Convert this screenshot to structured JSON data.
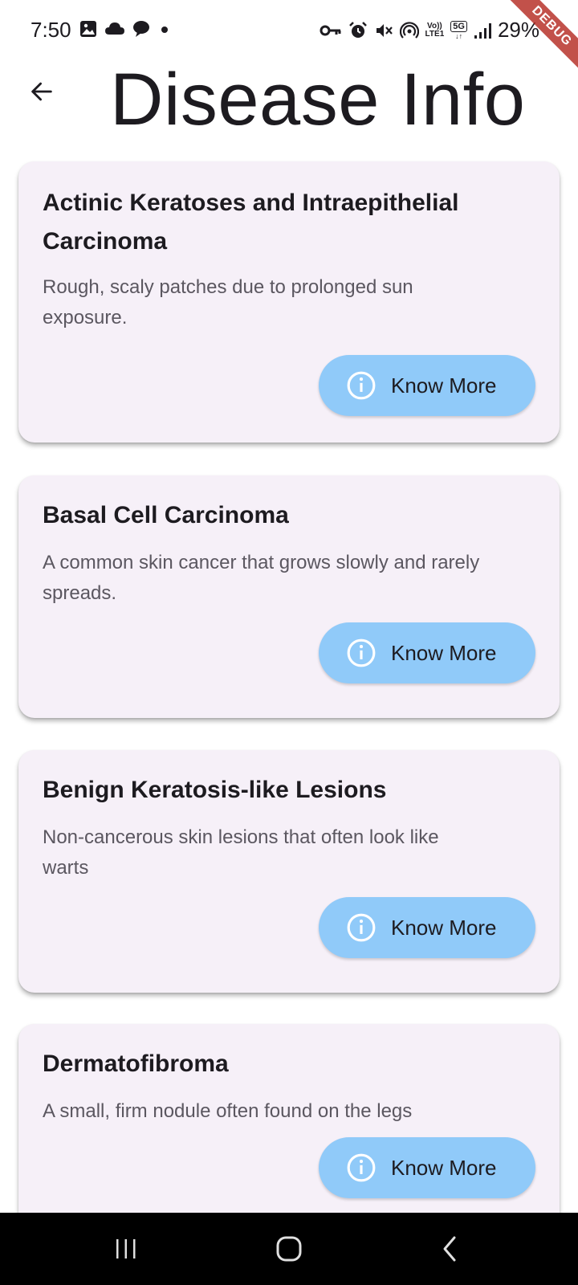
{
  "status_bar": {
    "time": "7:50",
    "left_icons": [
      "image-icon",
      "cloud-icon",
      "chat-icon",
      "dot-icon"
    ],
    "right_icons": [
      "key-icon",
      "alarm-icon",
      "mute-icon",
      "hotspot-icon",
      "volte-icon",
      "5g-icon",
      "signal-icon",
      "battery-icon"
    ],
    "volte_label_top": "Vo))",
    "volte_label_bottom": "LTE1",
    "network_label": "5G",
    "battery": "29%"
  },
  "debug_banner": "DEBUG",
  "app_bar": {
    "title": "Disease Info",
    "back_icon": "arrow-back-icon"
  },
  "colors": {
    "card_background": "#f6f0f8",
    "button_background": "#90caf9",
    "debug_banner": "#b3261e"
  },
  "diseases": [
    {
      "name": "Actinic Keratoses and Intraepithelial Carcinoma",
      "description": "Rough, scaly patches due to prolonged sun exposure.",
      "button_label": "Know More",
      "button_icon": "info-icon"
    },
    {
      "name": "Basal Cell Carcinoma",
      "description": "A common skin cancer that grows slowly and rarely spreads.",
      "button_label": "Know More",
      "button_icon": "info-icon"
    },
    {
      "name": "Benign Keratosis-like Lesions",
      "description": "Non-cancerous skin lesions that often look like warts",
      "button_label": "Know More",
      "button_icon": "info-icon"
    },
    {
      "name": "Dermatofibroma",
      "description": "A small, firm nodule often found on the legs",
      "button_label": "Know More",
      "button_icon": "info-icon"
    }
  ],
  "nav_bar": {
    "buttons": [
      "recents-icon",
      "home-icon",
      "back-icon"
    ]
  }
}
